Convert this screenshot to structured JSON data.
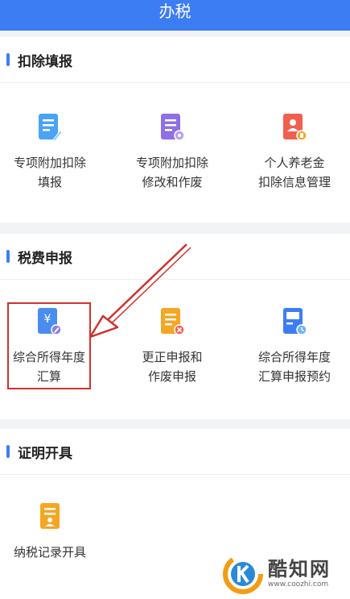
{
  "header": {
    "title": "办税"
  },
  "sections": [
    {
      "title": "扣除填报",
      "items": [
        {
          "line1": "专项附加扣除",
          "line2": "填报",
          "icon": "document-edit-icon"
        },
        {
          "line1": "专项附加扣除",
          "line2": "修改和作废",
          "icon": "document-settings-icon"
        },
        {
          "line1": "个人养老金",
          "line2": "扣除信息管理",
          "icon": "pension-document-icon"
        }
      ]
    },
    {
      "title": "税费申报",
      "items": [
        {
          "line1": "综合所得年度",
          "line2": "汇算",
          "icon": "yen-document-icon"
        },
        {
          "line1": "更正申报和",
          "line2": "作废申报",
          "icon": "document-cancel-icon"
        },
        {
          "line1": "综合所得年度",
          "line2": "汇算申报预约",
          "icon": "calendar-clock-icon"
        }
      ]
    },
    {
      "title": "证明开具",
      "items": [
        {
          "line1": "纳税记录开具",
          "line2": "",
          "icon": "certificate-document-icon"
        }
      ]
    }
  ],
  "watermark": {
    "name": "酷知网",
    "url": "www.coozhi.com"
  },
  "colors": {
    "accent": "#3d7df3",
    "highlight": "#d0312d"
  }
}
